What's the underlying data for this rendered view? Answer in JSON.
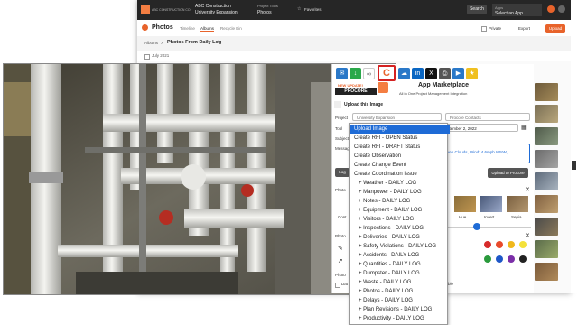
{
  "app": {
    "company": "ABC CONSTRUCTION CO",
    "project_line1": "ABC Construction",
    "project_line2": "University Expansion",
    "project_tools_label": "Project Tools",
    "project_tools_value": "Photos",
    "favorites": "Favorites",
    "search_label": "Search",
    "apps_label": "Apps",
    "apps_value": "Select an App",
    "page_title": "Photos",
    "tabs": [
      "Timeline",
      "Albums",
      "Recycle Bin"
    ],
    "private_label": "Private",
    "export_label": "Export",
    "upload_label": "Upload",
    "breadcrumb_root": "Albums",
    "album_title": "Photos From Daily Log",
    "date_header": "July 2021"
  },
  "panel": {
    "new_update_label": "NEW UPDATE!",
    "procore_label": "PROCORE",
    "marketplace_title": "App Marketplace",
    "marketplace_subtitle": "All in One Project Management Integration",
    "upload_heading": "Upload this Image",
    "project_label": "Project",
    "project_value": "University Expansion",
    "contacts_value": "Procore Contacts",
    "tool_label": "Tool",
    "date_value": "ptember 2, 2022",
    "subject_label": "Subject",
    "message_label": "Message",
    "message_text": "iven Clouds, Wind: 4.6mph WNW,",
    "log_button": "Log",
    "upload_button": "Upload to Procore",
    "photo_section": "Photo",
    "filter_labels": [
      "Hue",
      "Invert",
      "Sepia"
    ],
    "contrast_label": "Cont",
    "photo_section2": "Photo",
    "photo_section3": "Photo",
    "date_check": "Dat",
    "extra_text": "ble",
    "colors": [
      "#d72b2b",
      "#e84a2b",
      "#f0b81c",
      "#f4e13a",
      "#2a9a3c",
      "#1e57c8",
      "#7b2fa8",
      "#222222"
    ]
  },
  "dropdown": {
    "items": [
      {
        "label": "Upload Image",
        "level": "top",
        "selected": true
      },
      {
        "label": "Create RFI - OPEN Status",
        "level": "top"
      },
      {
        "label": "Create RFI - DRAFT Status",
        "level": "top"
      },
      {
        "label": "Create Observation",
        "level": "top"
      },
      {
        "label": "Create Change Event",
        "level": "top"
      },
      {
        "label": "Create Coordination Issue",
        "level": "top"
      },
      {
        "label": "+ Weather - DAILY LOG",
        "level": "sub"
      },
      {
        "label": "+ Manpower - DAILY LOG",
        "level": "sub"
      },
      {
        "label": "+ Notes - DAILY LOG",
        "level": "sub"
      },
      {
        "label": "+ Equipment - DAILY LOG",
        "level": "sub"
      },
      {
        "label": "+ Visitors - DAILY LOG",
        "level": "sub"
      },
      {
        "label": "+ Inspections - DAILY LOG",
        "level": "sub"
      },
      {
        "label": "+ Deliveries - DAILY LOG",
        "level": "sub"
      },
      {
        "label": "+ Safety Violations - DAILY LOG",
        "level": "sub"
      },
      {
        "label": "+ Accidents - DAILY LOG",
        "level": "sub"
      },
      {
        "label": "+ Quantities - DAILY LOG",
        "level": "sub"
      },
      {
        "label": "+ Dumpster - DAILY LOG",
        "level": "sub"
      },
      {
        "label": "+ Waste - DAILY LOG",
        "level": "sub"
      },
      {
        "label": "+ Photos - DAILY LOG",
        "level": "sub"
      },
      {
        "label": "+ Delays - DAILY LOG",
        "level": "sub"
      },
      {
        "label": "+ Plan Revisions - DAILY LOG",
        "level": "sub"
      },
      {
        "label": "+ Productivity - DAILY LOG",
        "level": "sub"
      }
    ]
  }
}
